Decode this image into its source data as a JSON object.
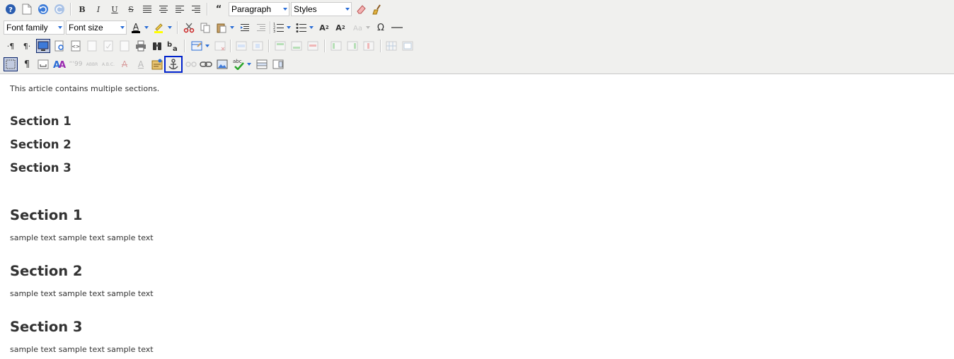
{
  "toolbar": {
    "format_select": "Paragraph",
    "styles_select": "Styles",
    "font_family_select": "Font family",
    "font_size_select": "Font size"
  },
  "content": {
    "intro": "This article contains multiple sections.",
    "toc": [
      "Section 1",
      "Section 2",
      "Section 3"
    ],
    "sections": [
      {
        "heading": "Section 1",
        "text": "sample text sample text sample text"
      },
      {
        "heading": "Section 2",
        "text": "sample text sample text sample text"
      },
      {
        "heading": "Section 3",
        "text": "sample text sample text sample text"
      }
    ]
  },
  "colors": {
    "toolbar_bg": "#f0f0ee",
    "accent_blue": "#2a6dd6",
    "highlight_border": "#0022cc",
    "text": "#333333"
  }
}
